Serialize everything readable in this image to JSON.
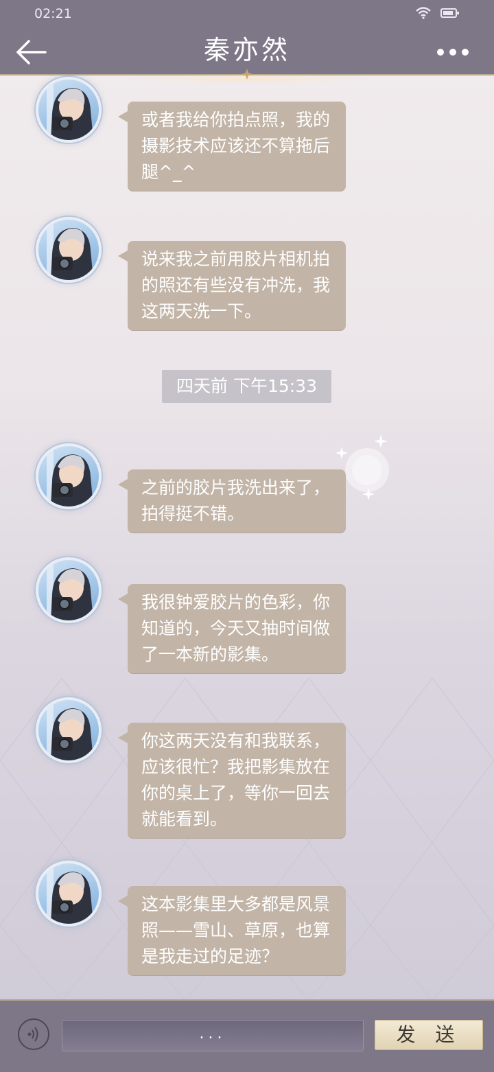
{
  "status_bar": {
    "time": "02:21",
    "icons": [
      "wifi-icon",
      "battery-icon"
    ]
  },
  "header": {
    "title": "秦亦然",
    "back_icon": "arrow-left-icon",
    "more_icon": "ellipsis-icon"
  },
  "messages": [
    {
      "sender": "avatar",
      "text": "或者我给你拍点照，我的摄影技术应该还不算拖后腿^_^"
    },
    {
      "sender": "avatar",
      "text": "说来我之前用胶片相机拍的照还有些没有冲洗，我这两天洗一下。"
    },
    {
      "type": "timestamp",
      "text": "四天前 下午15:33"
    },
    {
      "sender": "avatar",
      "text": "之前的胶片我洗出来了，拍得挺不错。"
    },
    {
      "sender": "avatar",
      "text": "我很钟爱胶片的色彩，你知道的，今天又抽时间做了一本新的影集。"
    },
    {
      "sender": "avatar",
      "text": "你这两天没有和我联系，应该很忙？我把影集放在你的桌上了，等你一回去就能看到。"
    },
    {
      "sender": "avatar",
      "text": "这本影集里大多都是风景照——雪山、草原，也算是我走过的足迹？"
    }
  ],
  "input_bar": {
    "input_value": "...",
    "send_label": "发 送",
    "voice_icon": "voice-icon"
  },
  "colors": {
    "bar": "#7d7788",
    "bubble": "#c2b4a6",
    "gold_border": "#b6a98f"
  }
}
